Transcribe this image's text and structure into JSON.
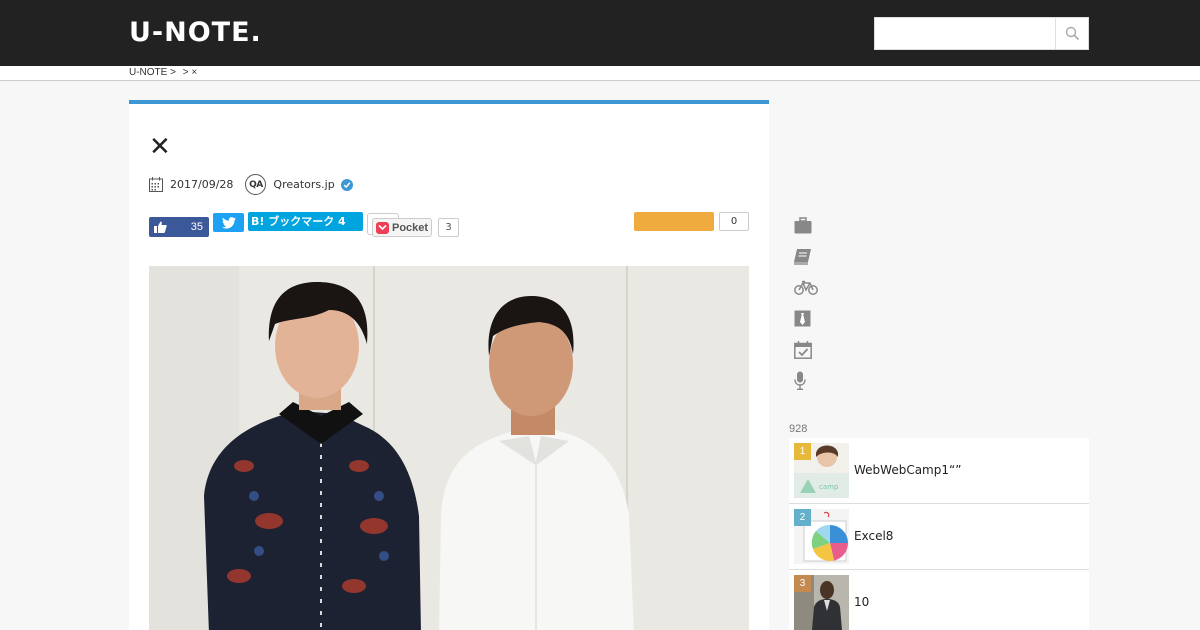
{
  "header": {
    "logo": "U-NOTE.",
    "search_placeholder": ""
  },
  "breadcrumb": {
    "items": [
      "U-NOTE >",
      "> ×"
    ]
  },
  "article": {
    "close_glyph": "✕",
    "date": "2017/09/28",
    "author_logo": "QA",
    "author": "Qreators.jp",
    "shares": {
      "like_count": "35",
      "hatena_label": "B! ブックマーク 4",
      "pocket_label": "Pocket",
      "pocket_count": "3",
      "other_count": "0"
    }
  },
  "sidebar": {
    "categories": [
      {
        "icon": "briefcase-icon"
      },
      {
        "icon": "book-icon"
      },
      {
        "icon": "bicycle-icon"
      },
      {
        "icon": "necktie-icon"
      },
      {
        "icon": "calendar-check-icon"
      },
      {
        "icon": "microphone-icon"
      }
    ],
    "ranking_count": "928",
    "ranking": [
      {
        "rank": "1",
        "title": "WebWebCamp1“”",
        "color": "#e7b93a"
      },
      {
        "rank": "2",
        "title": "Excel8",
        "color": "#62b0c9"
      },
      {
        "rank": "3",
        "title": "10",
        "color": "#c58a4f"
      }
    ]
  },
  "colors": {
    "header_bg": "#222222",
    "accent_blue": "#3d97d4",
    "facebook": "#3b5998",
    "twitter": "#1da1f2",
    "hatena": "#00a4de",
    "orange": "#f0ab3e"
  }
}
